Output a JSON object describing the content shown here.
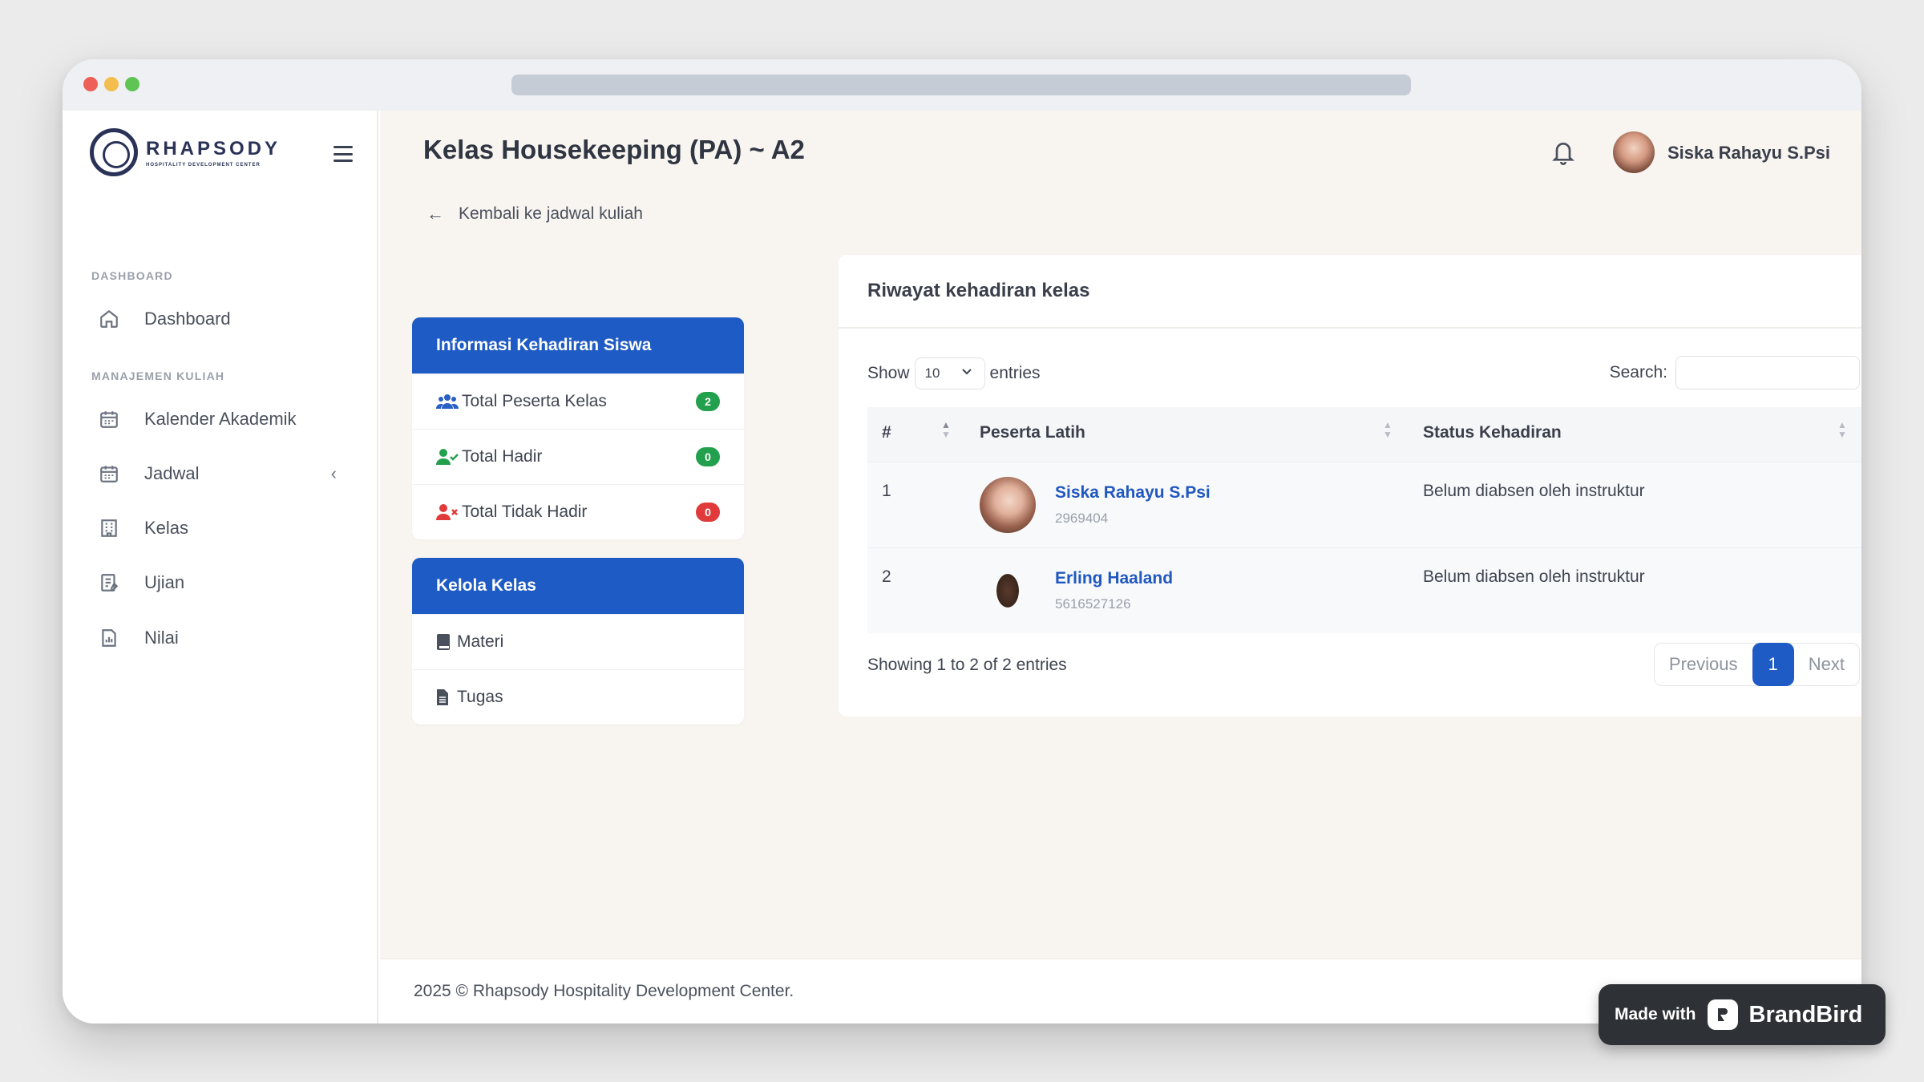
{
  "app": {
    "logo_title": "RHAPSODY",
    "logo_subtitle": "HOSPITALITY DEVELOPMENT CENTER"
  },
  "sidebar": {
    "section_dashboard": "DASHBOARD",
    "section_manajemen": "MANAJEMEN KULIAH",
    "items": [
      {
        "label": "Dashboard",
        "icon": "home-icon"
      },
      {
        "label": "Kalender Akademik",
        "icon": "calendar-icon"
      },
      {
        "label": "Jadwal",
        "icon": "calendar-icon"
      },
      {
        "label": "Kelas",
        "icon": "building-icon"
      },
      {
        "label": "Ujian",
        "icon": "exam-icon"
      },
      {
        "label": "Nilai",
        "icon": "grade-icon"
      }
    ]
  },
  "header": {
    "page_title": "Kelas Housekeeping (PA) ~ A2",
    "user_name": "Siska Rahayu S.Psi"
  },
  "back_link": "Kembali ke jadwal kuliah",
  "attendance_panel": {
    "title": "Informasi Kehadiran Siswa",
    "rows": [
      {
        "label": "Total Peserta Kelas",
        "count": "2",
        "color": "#23a04e"
      },
      {
        "label": "Total Hadir",
        "count": "0",
        "color": "#23a04e"
      },
      {
        "label": "Total Tidak Hadir",
        "count": "0",
        "color": "#e03a3a"
      }
    ]
  },
  "manage_panel": {
    "title": "Kelola Kelas",
    "rows": [
      {
        "label": "Materi",
        "icon": "book-icon"
      },
      {
        "label": "Tugas",
        "icon": "file-icon"
      }
    ]
  },
  "history_card": {
    "title": "Riwayat kehadiran kelas",
    "show_label": "Show",
    "entries_value": "10",
    "entries_label": "entries",
    "search_label": "Search:",
    "search_value": "",
    "columns": [
      "#",
      "Peserta Latih",
      "Status Kehadiran"
    ],
    "rows": [
      {
        "num": "1",
        "name": "Siska Rahayu S.Psi",
        "id": "2969404",
        "status": "Belum diabsen oleh instruktur"
      },
      {
        "num": "2",
        "name": "Erling Haaland",
        "id": "5616527126",
        "status": "Belum diabsen oleh instruktur"
      }
    ],
    "showing_text": "Showing 1 to 2 of 2 entries",
    "pager": {
      "previous": "Previous",
      "current": "1",
      "next": "Next"
    }
  },
  "footer": {
    "text": "2025 © Rhapsody Hospitality Development Center."
  },
  "watermark": {
    "made_with": "Made with",
    "brand": "BrandBird"
  },
  "colors": {
    "primary": "#1f5bc4",
    "link": "#2158bf",
    "success": "#23a04e",
    "danger": "#e03a3a"
  }
}
